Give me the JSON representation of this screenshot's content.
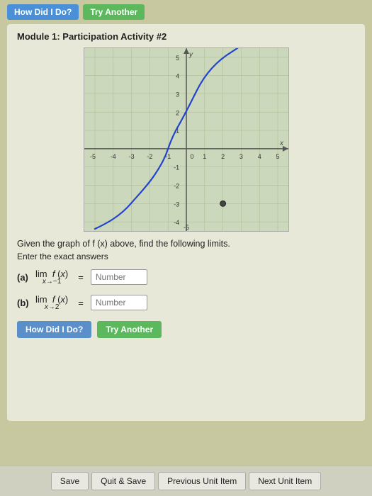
{
  "topBar": {
    "btn1": "How Did I Do?",
    "btn2": "Try Another"
  },
  "moduleTitle": "Module 1: Participation Activity #2",
  "graph": {
    "xMin": -5,
    "xMax": 5,
    "yMin": -5,
    "yMax": 5,
    "xLabel": "x",
    "yLabel": "y",
    "dotX": 2,
    "dotY": -3
  },
  "instructions": "Given the graph of f (x) above, find the following limits.",
  "instructionsSub": "Enter the exact answers",
  "questions": [
    {
      "label": "(a)",
      "limitExpr": "lim f(x) =",
      "limitSub": "x→−1",
      "placeholder": "Number"
    },
    {
      "label": "(b)",
      "limitExpr": "lim f(x) =",
      "limitSub": "x→2",
      "placeholder": "Number"
    }
  ],
  "actionButtons": {
    "howDidIDo": "How Did I Do?",
    "tryAnother": "Try Another"
  },
  "footer": {
    "save": "Save",
    "quitSave": "Quit & Save",
    "prevUnit": "Previous Unit Item",
    "nextUnit": "Next Unit Item"
  }
}
